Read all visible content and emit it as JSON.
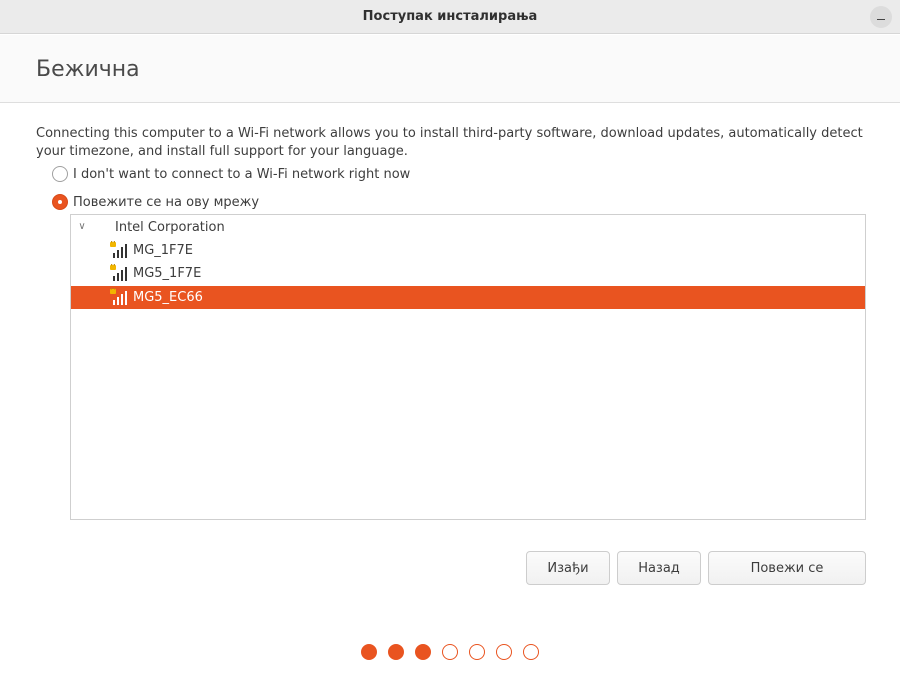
{
  "window": {
    "title": "Поступак инсталирања"
  },
  "page": {
    "heading": "Бежична",
    "description": "Connecting this computer to a Wi-Fi network allows you to install third-party software, download updates, automatically detect your timezone, and install full support for your language."
  },
  "options": [
    {
      "label": "I don't want to connect to a Wi-Fi network right now",
      "checked": false
    },
    {
      "label": "Повежите се на ову мрежу",
      "checked": true
    }
  ],
  "networks": {
    "vendor": "Intel Corporation",
    "items": [
      {
        "ssid": "MG_1F7E",
        "secured": true,
        "selected": false
      },
      {
        "ssid": "MG5_1F7E",
        "secured": true,
        "selected": false
      },
      {
        "ssid": "MG5_EC66",
        "secured": true,
        "selected": true
      }
    ]
  },
  "buttons": {
    "quit": "Изађи",
    "back": "Назад",
    "connect": "Повежи се"
  },
  "progress": {
    "total_steps": 7,
    "completed_steps": 3
  },
  "colors": {
    "accent": "#e95420"
  }
}
